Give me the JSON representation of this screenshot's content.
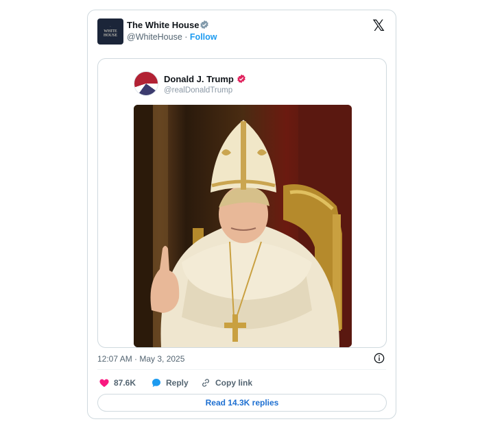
{
  "tweet": {
    "author_name": "The White House",
    "author_handle": "@WhiteHouse",
    "separator": "·",
    "follow_label": "Follow",
    "avatar_text": [
      "WHITE",
      "HOUSE"
    ],
    "brand_icon": "x-logo-icon",
    "timestamp": "12:07 AM · May 3, 2025",
    "likes": "87.6K",
    "reply_label": "Reply",
    "copy_link_label": "Copy link",
    "read_replies_label": "Read 14.3K replies"
  },
  "quoted": {
    "author_name": "Donald J. Trump",
    "author_handle": "@realDonaldTrump",
    "image": "ai-image-pope"
  },
  "colors": {
    "accent": "#1d9bf0",
    "like": "#f91880",
    "verified_gray": "#829aab",
    "verified_pink": "#e0245e",
    "text": "#0f1419",
    "muted": "#536471"
  }
}
